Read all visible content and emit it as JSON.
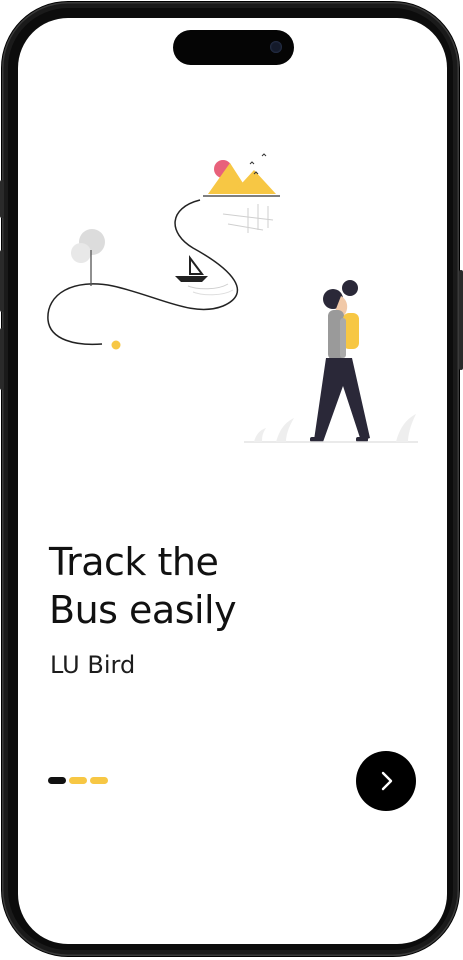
{
  "onboarding": {
    "title_line1": "Track the",
    "title_line2": "Bus easily",
    "subtitle": "LU Bird"
  },
  "pagination": {
    "total": 3,
    "active_index": 0
  },
  "next_button": {
    "icon": "chevron-right-icon"
  },
  "colors": {
    "accent": "#f7c744",
    "dark": "#111111",
    "background": "#ffffff",
    "sun": "#e8617b"
  }
}
